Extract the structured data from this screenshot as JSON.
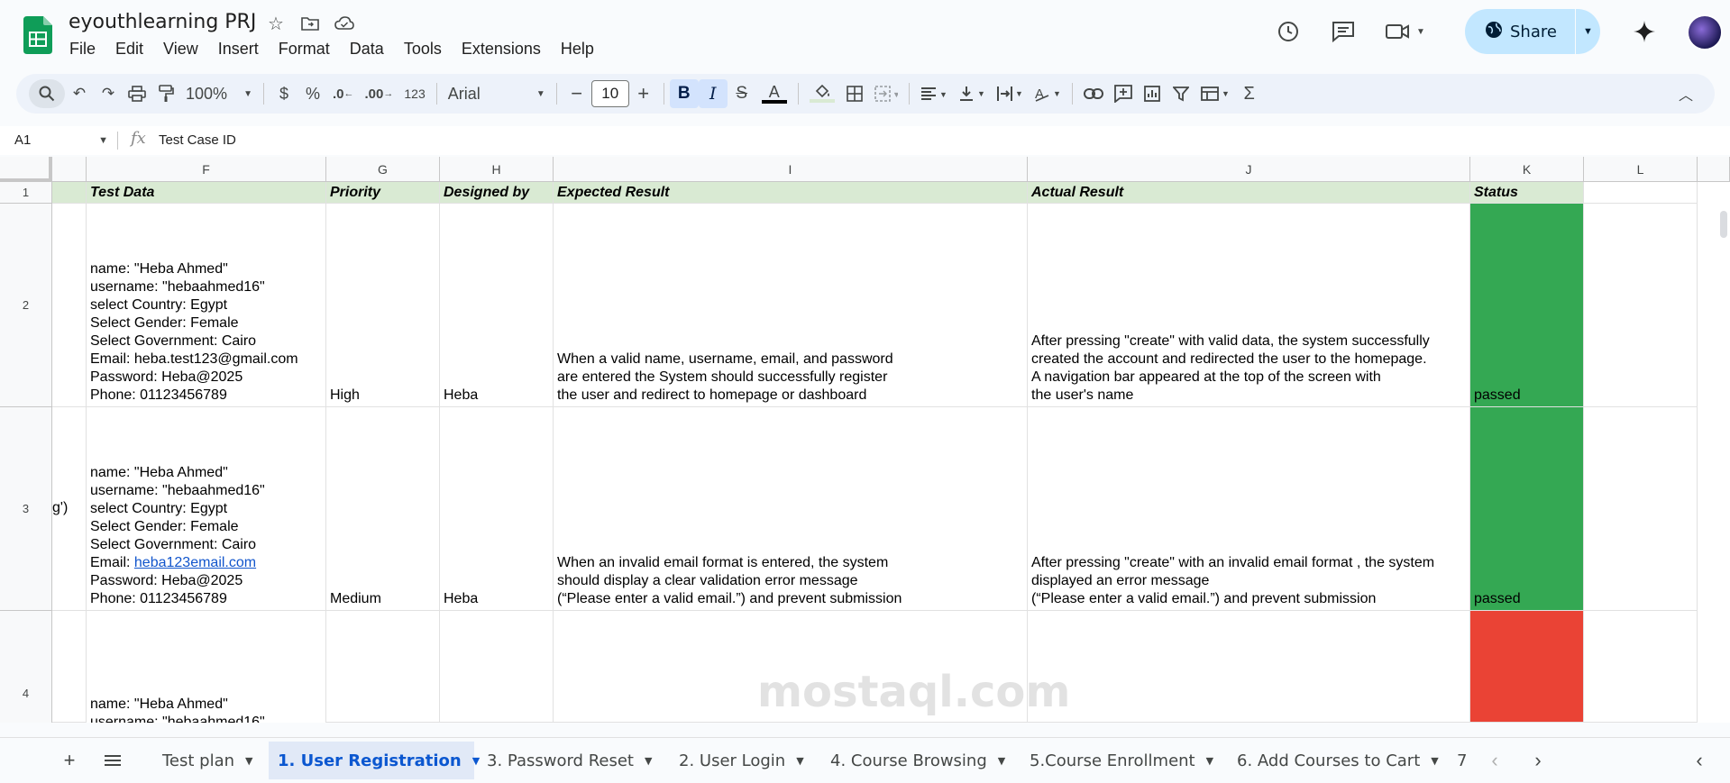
{
  "doc": {
    "title": "eyouthlearning PRJ"
  },
  "menu": [
    "File",
    "Edit",
    "View",
    "Insert",
    "Format",
    "Data",
    "Tools",
    "Extensions",
    "Help"
  ],
  "share": {
    "label": "Share"
  },
  "toolbar": {
    "zoom": "100%",
    "currency": "$",
    "percent": "%",
    "dec_decrease": ".0",
    "dec_increase": ".00",
    "number_format": "123",
    "font": "Arial",
    "font_size": "10"
  },
  "formula": {
    "cell_ref": "A1",
    "content": "Test Case ID"
  },
  "columns": [
    "F",
    "G",
    "H",
    "I",
    "J",
    "K",
    "L"
  ],
  "rows": [
    "1",
    "2",
    "3",
    "4"
  ],
  "header_row": {
    "test_data": "Test Data",
    "priority": "Priority",
    "designed_by": "Designed by",
    "expected": "Expected Result",
    "actual": "Actual Result",
    "status": "Status"
  },
  "row2": {
    "e_fragment": "",
    "test_data": "name: \"Heba Ahmed\"\nusername: \"hebaahmed16\"\nselect Country: Egypt\nSelect Gender: Female\nSelect Government: Cairo\nEmail: heba.test123@gmail.com\nPassword: Heba@2025\nPhone: 01123456789",
    "priority": "High",
    "designed_by": "Heba",
    "expected": "When a valid name, username, email, and password\nare entered the System should successfully register\nthe user and redirect to homepage or dashboard",
    "actual": "After pressing \"create\" with valid data, the system successfully\ncreated the account and redirected the user to the homepage.\nA navigation bar appeared at the top of the screen with\nthe user's name",
    "status": "passed"
  },
  "row3": {
    "e_fragment": "g')",
    "test_data_pre": "name: \"Heba Ahmed\"\nusername: \"hebaahmed16\"\nselect Country: Egypt\nSelect Gender: Female\nSelect Government: Cairo",
    "email_label": "Email: ",
    "email_link": "heba123email.com",
    "test_data_post": "Password: Heba@2025\nPhone: 01123456789",
    "priority": "Medium",
    "designed_by": "Heba",
    "expected": "When an invalid email format is entered, the system\nshould display a clear validation error message\n(“Please enter a valid email.”) and prevent submission",
    "actual": "After pressing \"create\" with an invalid email format , the system\ndisplayed an error message\n(“Please enter a valid email.”) and prevent submission",
    "status": "passed"
  },
  "row4": {
    "test_data": "name: \"Heba Ahmed\"\nusername: \"hebaahmed16\""
  },
  "tabs": [
    {
      "label": "Test plan",
      "active": false
    },
    {
      "label": "1. User Registration",
      "active": true
    },
    {
      "label": "3. Password Reset",
      "active": false
    },
    {
      "label": "2. User Login",
      "active": false
    },
    {
      "label": "4. Course Browsing",
      "active": false
    },
    {
      "label": "5.Course Enrollment",
      "active": false
    },
    {
      "label": "6. Add Courses to Cart",
      "active": false
    },
    {
      "label": "7",
      "active": false
    }
  ],
  "watermark": "mostaql.com",
  "colors": {
    "status_pass": "#34a853",
    "status_fail": "#ea4335",
    "header_fill": "#d9ead3",
    "share_bg": "#c2e7ff"
  }
}
